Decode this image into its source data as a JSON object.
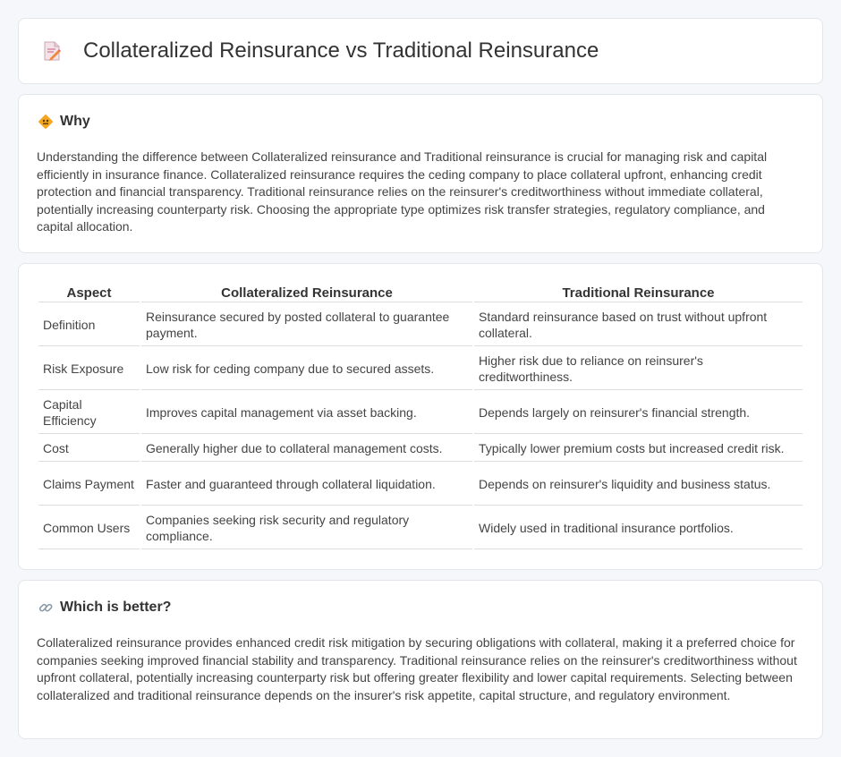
{
  "page": {
    "title": "Collateralized Reinsurance vs Traditional Reinsurance"
  },
  "why": {
    "title": "Why",
    "body": "Understanding the difference between Collateralized reinsurance and Traditional reinsurance is crucial for managing risk and capital efficiently in insurance finance. Collateralized reinsurance requires the ceding company to place collateral upfront, enhancing credit protection and financial transparency. Traditional reinsurance relies on the reinsurer's creditworthiness without immediate collateral, potentially increasing counterparty risk. Choosing the appropriate type optimizes risk transfer strategies, regulatory compliance, and capital allocation."
  },
  "table": {
    "headers": [
      "Aspect",
      "Collateralized Reinsurance",
      "Traditional Reinsurance"
    ],
    "rows": [
      [
        "Definition",
        "Reinsurance secured by posted collateral to guarantee payment.",
        "Standard reinsurance based on trust without upfront collateral."
      ],
      [
        "Risk Exposure",
        "Low risk for ceding company due to secured assets.",
        "Higher risk due to reliance on reinsurer's creditworthiness."
      ],
      [
        "Capital Efficiency",
        "Improves capital management via asset backing.",
        "Depends largely on reinsurer's financial strength."
      ],
      [
        "Cost",
        "Generally higher due to collateral management costs.",
        "Typically lower premium costs but increased credit risk."
      ],
      [
        "Claims Payment",
        "Faster and guaranteed through collateral liquidation.",
        "Depends on reinsurer's liquidity and business status."
      ],
      [
        "Common Users",
        "Companies seeking risk security and regulatory compliance.",
        "Widely used in traditional insurance portfolios."
      ]
    ]
  },
  "better": {
    "title": "Which is better?",
    "body": "Collateralized reinsurance provides enhanced credit risk mitigation by securing obligations with collateral, making it a preferred choice for companies seeking improved financial stability and transparency. Traditional reinsurance relies on the reinsurer's creditworthiness without upfront collateral, potentially increasing counterparty risk but offering greater flexibility and lower capital requirements. Selecting between collateralized and traditional reinsurance depends on the insurer's risk appetite, capital structure, and regulatory environment."
  },
  "icons": {
    "header": "document-pencil-icon",
    "why": "diamond-sign-icon",
    "better": "link-icon"
  }
}
